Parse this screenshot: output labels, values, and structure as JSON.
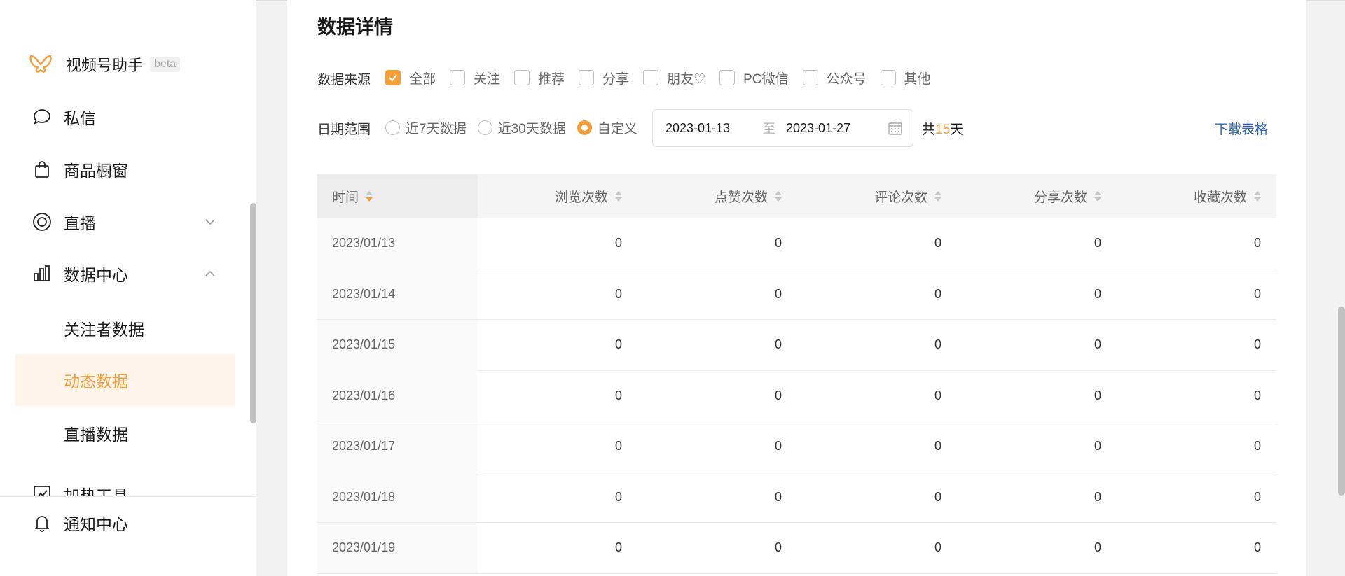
{
  "brand": {
    "name": "视频号助手",
    "badge": "beta",
    "logo_icon": "butterfly-logo-icon",
    "accent_color": "#f59f3b"
  },
  "sidebar": {
    "items": [
      {
        "label": "私信",
        "icon": "chat-bubble-icon"
      },
      {
        "label": "商品橱窗",
        "icon": "shopping-bag-icon"
      },
      {
        "label": "直播",
        "icon": "live-circle-icon",
        "chevron": "chevron-down-icon"
      },
      {
        "label": "数据中心",
        "icon": "bar-chart-icon",
        "chevron": "chevron-up-icon"
      },
      {
        "label": "关注者数据"
      },
      {
        "label": "动态数据",
        "active": true
      },
      {
        "label": "直播数据"
      },
      {
        "label": "加热工具",
        "icon": "trend-icon"
      },
      {
        "label": "通知中心",
        "icon": "bell-icon"
      }
    ]
  },
  "main": {
    "title": "数据详情",
    "source": {
      "label": "数据来源",
      "options": [
        {
          "label": "全部",
          "checked": true
        },
        {
          "label": "关注",
          "checked": false
        },
        {
          "label": "推荐",
          "checked": false
        },
        {
          "label": "分享",
          "checked": false
        },
        {
          "label": "朋友♡",
          "checked": false
        },
        {
          "label": "PC微信",
          "checked": false
        },
        {
          "label": "公众号",
          "checked": false
        },
        {
          "label": "其他",
          "checked": false
        }
      ]
    },
    "date": {
      "label": "日期范围",
      "options": [
        {
          "label": "近7天数据",
          "checked": false
        },
        {
          "label": "近30天数据",
          "checked": false
        },
        {
          "label": "自定义",
          "checked": true
        }
      ],
      "start": "2023-01-13",
      "separator": "至",
      "end": "2023-01-27",
      "total_prefix": "共",
      "total_days": "15",
      "total_suffix": "天"
    },
    "download_label": "下载表格"
  },
  "table": {
    "columns": [
      "时间",
      "浏览次数",
      "点赞次数",
      "评论次数",
      "分享次数",
      "收藏次数"
    ],
    "rows": [
      [
        "2023/01/13",
        "0",
        "0",
        "0",
        "0",
        "0"
      ],
      [
        "2023/01/14",
        "0",
        "0",
        "0",
        "0",
        "0"
      ],
      [
        "2023/01/15",
        "0",
        "0",
        "0",
        "0",
        "0"
      ],
      [
        "2023/01/16",
        "0",
        "0",
        "0",
        "0",
        "0"
      ],
      [
        "2023/01/17",
        "0",
        "0",
        "0",
        "0",
        "0"
      ],
      [
        "2023/01/18",
        "0",
        "0",
        "0",
        "0",
        "0"
      ],
      [
        "2023/01/19",
        "0",
        "0",
        "0",
        "0",
        "0"
      ]
    ]
  }
}
